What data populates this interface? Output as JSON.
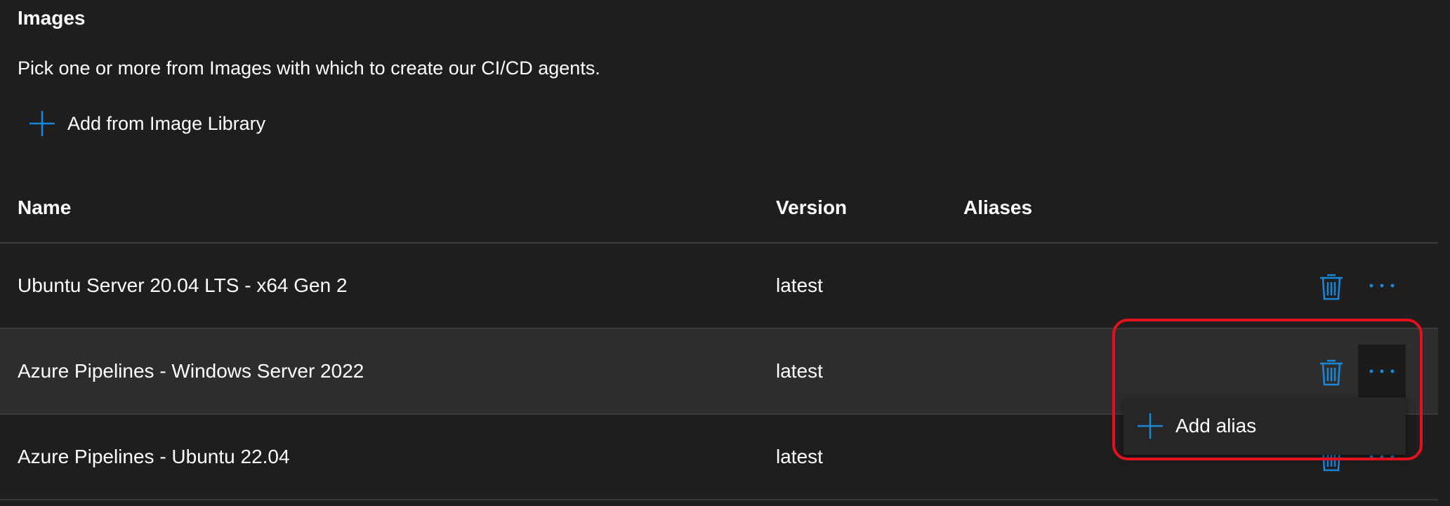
{
  "section": {
    "title": "Images",
    "description": "Pick one or more from Images with which to create our CI/CD agents.",
    "add_button_label": "Add from Image Library"
  },
  "table": {
    "columns": [
      "Name",
      "Version",
      "Aliases"
    ],
    "rows": [
      {
        "name": "Ubuntu Server 20.04 LTS - x64 Gen 2",
        "version": "latest",
        "aliases": ""
      },
      {
        "name": "Azure Pipelines - Windows Server 2022",
        "version": "latest",
        "aliases": ""
      },
      {
        "name": "Azure Pipelines - Ubuntu 22.04",
        "version": "latest",
        "aliases": ""
      }
    ]
  },
  "context_menu": {
    "items": [
      {
        "label": "Add alias",
        "icon": "plus-icon"
      }
    ]
  },
  "icons": {
    "delete": "trash-icon",
    "more": "more-horizontal-icon",
    "add": "plus-icon"
  },
  "colors": {
    "background": "#1e1e1e",
    "selected_row": "#2d2d2d",
    "accent_blue": "#1a86d8",
    "highlight_red": "#e3101d"
  }
}
